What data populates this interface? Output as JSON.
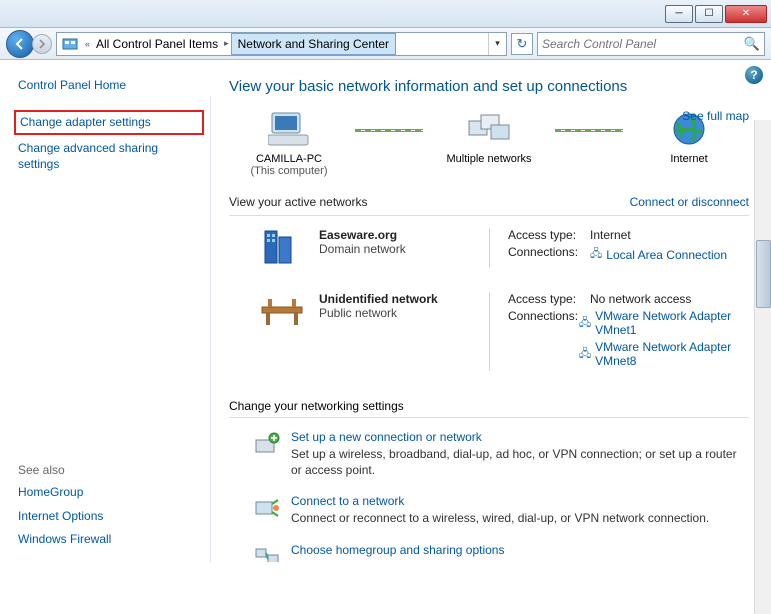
{
  "titlebar": {
    "min": "—",
    "max": "▢",
    "close": "✕"
  },
  "address": {
    "crumb1": "All Control Panel Items",
    "crumb2": "Network and Sharing Center",
    "search_placeholder": "Search Control Panel"
  },
  "sidebar": {
    "home": "Control Panel Home",
    "adapter": "Change adapter settings",
    "advanced": "Change advanced sharing settings",
    "seealso": "See also",
    "homegroup": "HomeGroup",
    "inetopt": "Internet Options",
    "firewall": "Windows Firewall"
  },
  "content": {
    "title": "View your basic network information and set up connections",
    "seefull": "See full map",
    "map": {
      "pc_name": "CAMILLA-PC",
      "pc_sub": "(This computer)",
      "multi": "Multiple networks",
      "internet": "Internet"
    },
    "active_hdr": "View your active networks",
    "connect_link": "Connect or disconnect",
    "net1": {
      "name": "Easeware.org",
      "type": "Domain network",
      "access_label": "Access type:",
      "access_val": "Internet",
      "conn_label": "Connections:",
      "conn_link": "Local Area Connection"
    },
    "net2": {
      "name": "Unidentified network",
      "type": "Public network",
      "access_label": "Access type:",
      "access_val": "No network access",
      "conn_label": "Connections:",
      "conn_link1": "VMware Network Adapter VMnet1",
      "conn_link2": "VMware Network Adapter VMnet8"
    },
    "change_hdr": "Change your networking settings",
    "opt1": {
      "link": "Set up a new connection or network",
      "desc": "Set up a wireless, broadband, dial-up, ad hoc, or VPN connection; or set up a router or access point."
    },
    "opt2": {
      "link": "Connect to a network",
      "desc": "Connect or reconnect to a wireless, wired, dial-up, or VPN network connection."
    },
    "opt3": {
      "link": "Choose homegroup and sharing options"
    }
  }
}
